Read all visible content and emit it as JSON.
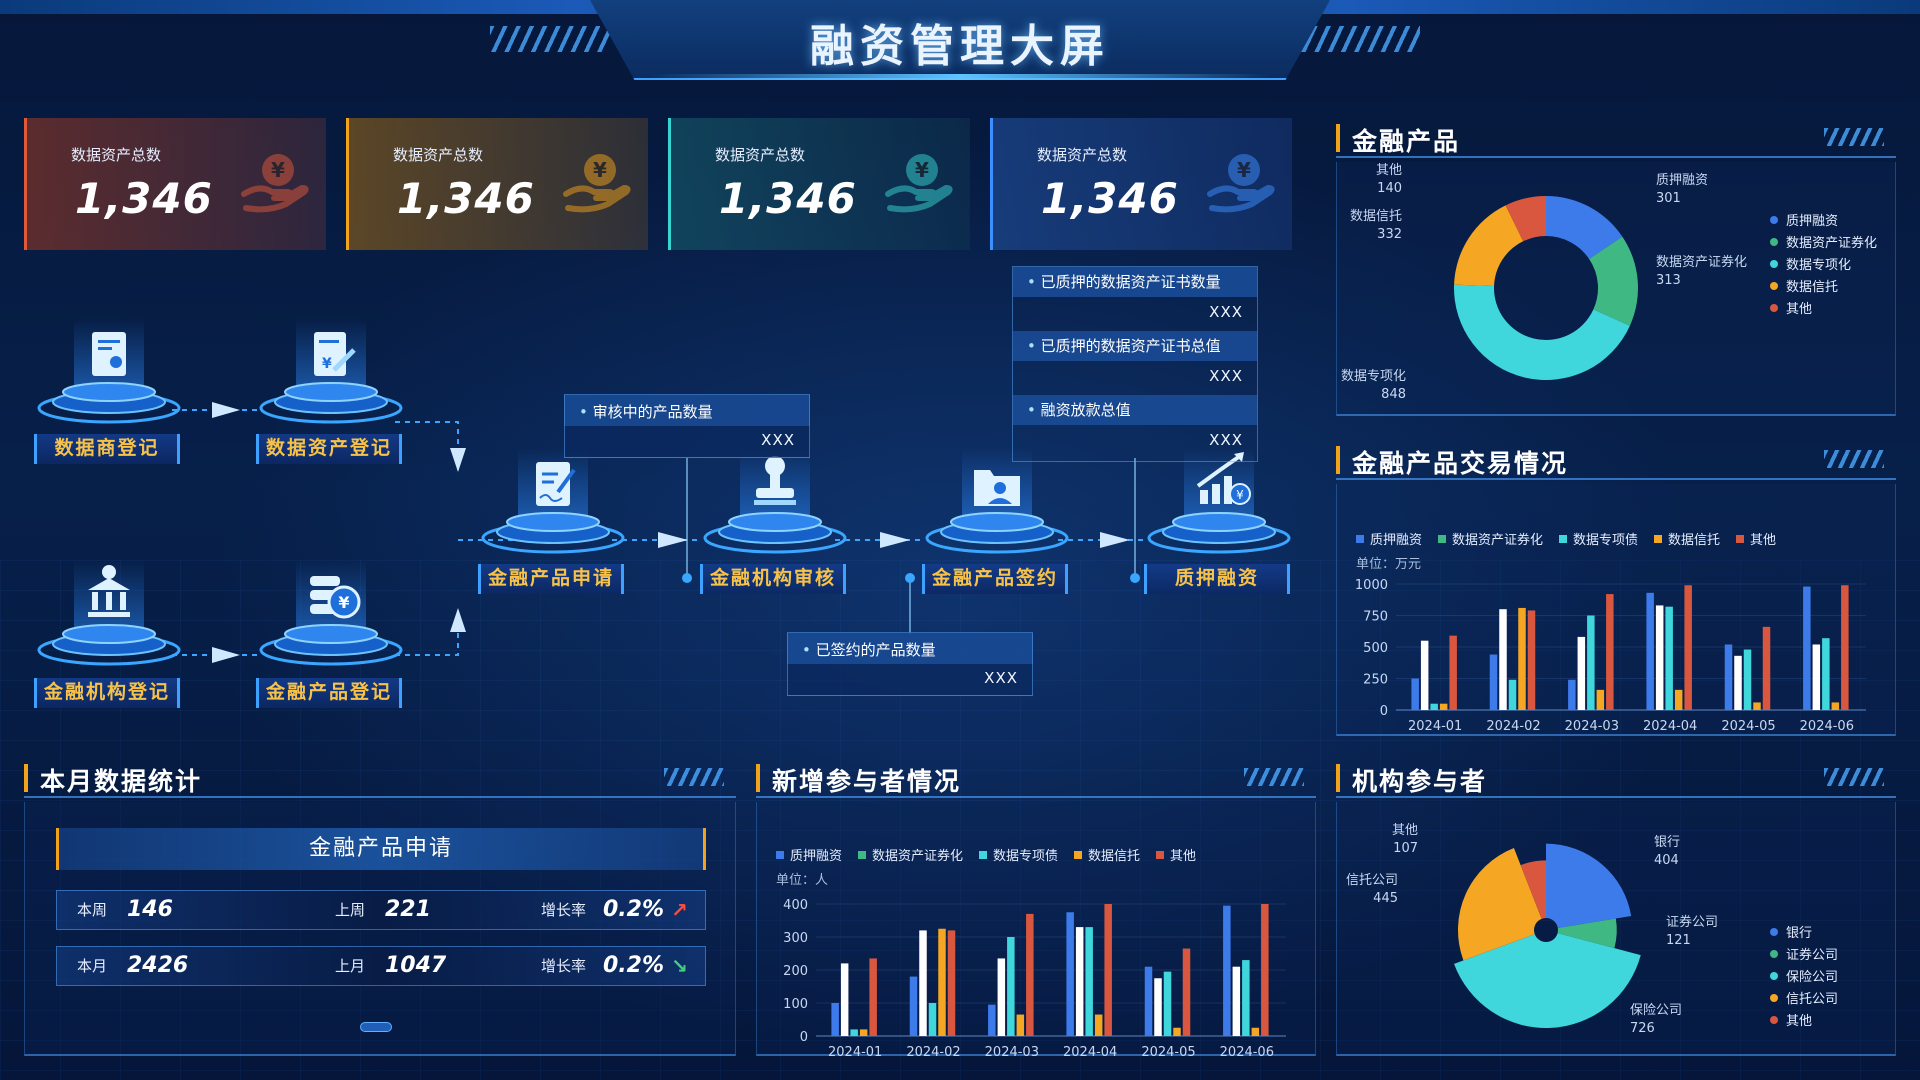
{
  "header": {
    "title": "融资管理大屏"
  },
  "stats": [
    {
      "label": "数据资产总数",
      "value": "1,346",
      "accent": "#e05a3a",
      "icon": "yen-hand-icon"
    },
    {
      "label": "数据资产总数",
      "value": "1,346",
      "accent": "#f2a21b",
      "icon": "yen-hand-icon"
    },
    {
      "label": "数据资产总数",
      "value": "1,346",
      "accent": "#37d5d2",
      "icon": "yen-hand-icon"
    },
    {
      "label": "数据资产总数",
      "value": "1,346",
      "accent": "#3d8fff",
      "icon": "yen-hand-icon"
    }
  ],
  "flow": {
    "nodes": {
      "data_vendor": "数据商登记",
      "data_asset": "数据资产登记",
      "fin_org": "金融机构登记",
      "fin_product": "金融产品登记",
      "apply": "金融产品申请",
      "review": "金融机构审核",
      "sign": "金融产品签约",
      "pledge": "质押融资"
    },
    "info": {
      "reviewing": {
        "title": "审核中的产品数量",
        "value": "XXX"
      },
      "signed": {
        "title": "已签约的产品数量",
        "value": "XXX"
      },
      "pledged_count": {
        "title": "已质押的数据资产证书数量",
        "value": "XXX"
      },
      "pledged_total": {
        "title": "已质押的数据资产证书总值",
        "value": "XXX"
      },
      "loan_total": {
        "title": "融资放款总值",
        "value": "XXX"
      }
    }
  },
  "panels": {
    "products": "金融产品",
    "trading": "金融产品交易情况",
    "monthly": "本月数据统计",
    "participants": "新增参与者情况",
    "institutions": "机构参与者"
  },
  "monthly": {
    "subtitle": "金融产品申请",
    "rows": [
      {
        "k1": "本周",
        "v1": "146",
        "k2": "上周",
        "v2": "221",
        "k3": "增长率",
        "v3": "0.2%",
        "trend": "up"
      },
      {
        "k1": "本月",
        "v1": "2426",
        "k2": "上月",
        "v2": "1047",
        "k3": "增长率",
        "v3": "0.2%",
        "trend": "down"
      }
    ]
  },
  "colors": [
    "#3d7bea",
    "#3fb884",
    "#3fd6dc",
    "#f5a623",
    "#d9573f"
  ],
  "chart_data": [
    {
      "id": "products",
      "type": "pie",
      "donut": true,
      "series": [
        {
          "name": "质押融资",
          "value": 301
        },
        {
          "name": "数据资产证券化",
          "value": 313
        },
        {
          "name": "数据专项化",
          "value": 848
        },
        {
          "name": "数据信托",
          "value": 332
        },
        {
          "name": "其他",
          "value": 140
        }
      ],
      "legend": [
        "质押融资",
        "数据资产证券化",
        "数据专项化",
        "数据信托",
        "其他"
      ]
    },
    {
      "id": "trading",
      "type": "bar",
      "unit": "单位：万元",
      "categories": [
        "2024-01",
        "2024-02",
        "2024-03",
        "2024-04",
        "2024-05",
        "2024-06"
      ],
      "ylim": [
        0,
        1000
      ],
      "yticks": [
        "0",
        "250",
        "500",
        "750",
        "1000"
      ],
      "series": [
        {
          "name": "质押融资",
          "values": [
            250,
            440,
            240,
            930,
            520,
            980
          ]
        },
        {
          "name": "数据资产证券化",
          "values": [
            550,
            800,
            580,
            830,
            430,
            520
          ]
        },
        {
          "name": "数据专项债",
          "values": [
            50,
            240,
            750,
            820,
            480,
            570
          ]
        },
        {
          "name": "数据信托",
          "values": [
            50,
            810,
            160,
            160,
            60,
            60
          ]
        },
        {
          "name": "其他",
          "values": [
            590,
            790,
            920,
            990,
            660,
            990
          ]
        }
      ]
    },
    {
      "id": "participants",
      "type": "bar",
      "unit": "单位：人",
      "categories": [
        "2024-01",
        "2024-02",
        "2024-03",
        "2024-04",
        "2024-05",
        "2024-06"
      ],
      "ylim": [
        0,
        400
      ],
      "yticks": [
        "0",
        "100",
        "200",
        "300",
        "400"
      ],
      "series": [
        {
          "name": "质押融资",
          "values": [
            100,
            180,
            95,
            375,
            210,
            395
          ]
        },
        {
          "name": "数据资产证券化",
          "values": [
            220,
            320,
            235,
            330,
            175,
            210
          ]
        },
        {
          "name": "数据专项债",
          "values": [
            20,
            100,
            300,
            330,
            195,
            230
          ]
        },
        {
          "name": "数据信托",
          "values": [
            20,
            325,
            65,
            65,
            25,
            25
          ]
        },
        {
          "name": "其他",
          "values": [
            235,
            320,
            370,
            400,
            265,
            400
          ]
        }
      ]
    },
    {
      "id": "institutions",
      "type": "pie",
      "rose": true,
      "series": [
        {
          "name": "银行",
          "value": 404
        },
        {
          "name": "证券公司",
          "value": 121
        },
        {
          "name": "保险公司",
          "value": 726
        },
        {
          "name": "信托公司",
          "value": 445
        },
        {
          "name": "其他",
          "value": 107
        }
      ],
      "legend": [
        "银行",
        "证券公司",
        "保险公司",
        "信托公司",
        "其他"
      ]
    }
  ]
}
